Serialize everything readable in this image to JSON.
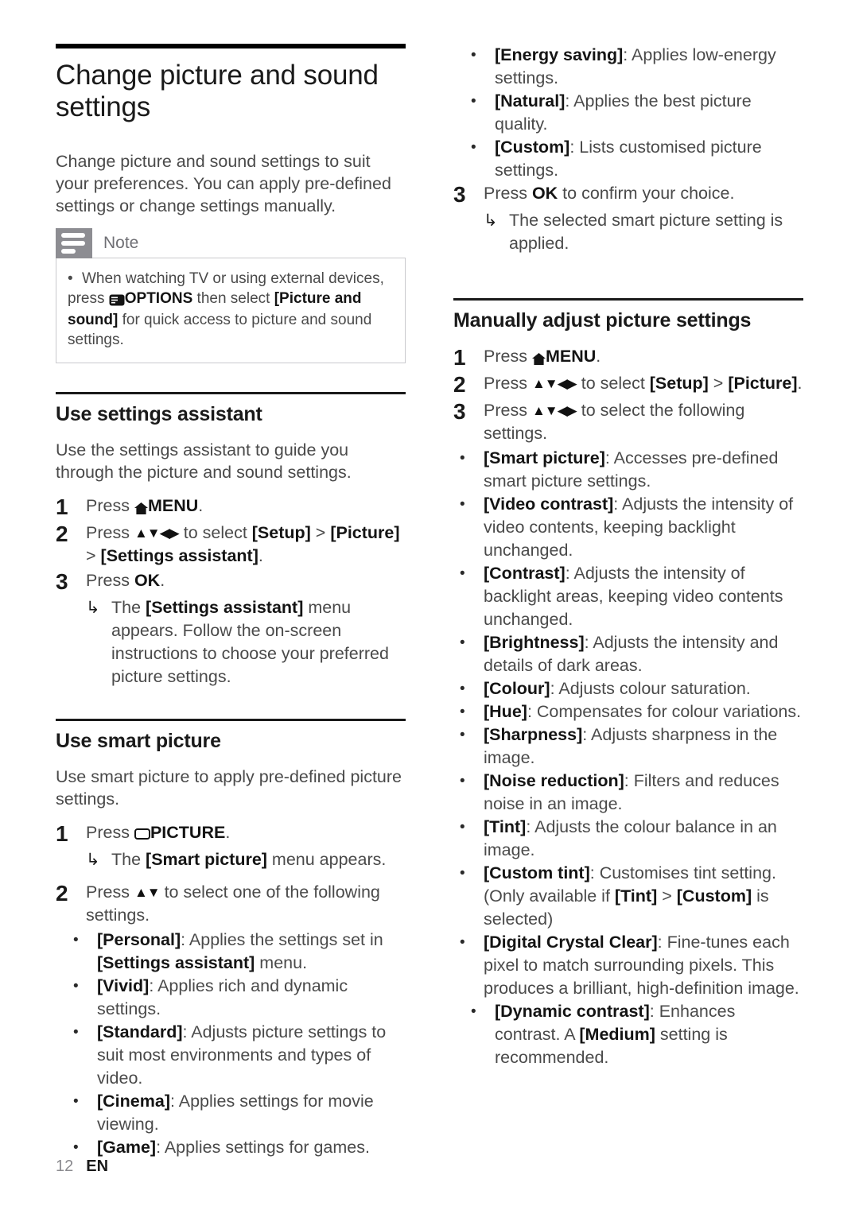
{
  "page": {
    "title": "Change picture and sound settings",
    "intro": "Change picture and sound settings to suit your preferences. You can apply pre-defined settings or change settings manually.",
    "footer_page_number": "12",
    "footer_language": "EN"
  },
  "note": {
    "label": "Note",
    "icon": "note-lines-icon",
    "bullet_pre": "When watching TV or using external devices, press ",
    "options_key": "OPTIONS",
    "bullet_mid": " then select ",
    "picture_and_sound": "[Picture and sound]",
    "bullet_post": " for quick access to picture and sound settings."
  },
  "settings_assistant": {
    "heading": "Use settings assistant",
    "intro": "Use the settings assistant to guide you through the picture and sound settings.",
    "steps": [
      {
        "num": "1",
        "pre": "Press ",
        "key": "MENU",
        "post": "."
      },
      {
        "num": "2",
        "pre": "Press ",
        "arrows": "▲▼◀▶",
        "mid": " to select ",
        "b1": "[Setup]",
        "sep": " > ",
        "b2": "[Picture]",
        "sep2": " > ",
        "b3": "[Settings assistant]",
        "post": "."
      },
      {
        "num": "3",
        "pre": "Press ",
        "key": "OK",
        "post": "."
      }
    ],
    "result": {
      "pre": "The ",
      "bold": "[Settings assistant]",
      "post": " menu appears. Follow the on-screen instructions to choose your preferred picture settings."
    }
  },
  "smart_picture": {
    "heading": "Use smart picture",
    "intro": "Use smart picture to apply pre-defined picture settings.",
    "step1": {
      "num": "1",
      "pre": "Press ",
      "key": "PICTURE",
      "post": "."
    },
    "step1_result": {
      "pre": "The ",
      "bold": "[Smart picture]",
      "post": " menu appears."
    },
    "step2": {
      "num": "2",
      "pre": "Press ",
      "arrows": "▲▼",
      "post": " to select one of the following settings."
    },
    "options": [
      {
        "name": "[Personal]",
        "desc": ": Applies the settings set in ",
        "bold2": "[Settings assistant]",
        "desc2": " menu."
      },
      {
        "name": "[Vivid]",
        "desc": ": Applies rich and dynamic settings."
      },
      {
        "name": "[Standard]",
        "desc": ": Adjusts picture settings to suit most environments and types of video."
      },
      {
        "name": "[Cinema]",
        "desc": ": Applies settings for movie viewing."
      },
      {
        "name": "[Game]",
        "desc": ": Applies settings for games."
      },
      {
        "name": "[Energy saving]",
        "desc": ": Applies low-energy settings."
      },
      {
        "name": "[Natural]",
        "desc": ": Applies the best picture quality."
      },
      {
        "name": "[Custom]",
        "desc": ": Lists customised picture settings."
      }
    ],
    "step3": {
      "num": "3",
      "pre": "Press ",
      "key": "OK",
      "post": " to confirm your choice."
    },
    "step3_result": {
      "text": "The selected smart picture setting is applied."
    }
  },
  "manual_picture": {
    "heading": "Manually adjust picture settings",
    "steps": [
      {
        "num": "1",
        "pre": "Press ",
        "key": "MENU",
        "post": "."
      },
      {
        "num": "2",
        "pre": "Press ",
        "arrows": "▲▼◀▶",
        "mid": " to select ",
        "b1": "[Setup]",
        "sep": " > ",
        "b2": "[Picture]",
        "post": "."
      },
      {
        "num": "3",
        "pre": "Press ",
        "arrows": "▲▼◀▶",
        "post": " to select the following settings."
      }
    ],
    "options": [
      {
        "name": "[Smart picture]",
        "desc": ": Accesses pre-defined smart picture settings."
      },
      {
        "name": "[Video contrast]",
        "desc": ": Adjusts the intensity of video contents, keeping backlight unchanged."
      },
      {
        "name": "[Contrast]",
        "desc": ": Adjusts the intensity of backlight areas, keeping video contents unchanged."
      },
      {
        "name": "[Brightness]",
        "desc": ": Adjusts the intensity and details of dark areas."
      },
      {
        "name": "[Colour]",
        "desc": ": Adjusts colour saturation."
      },
      {
        "name": "[Hue]",
        "desc": ": Compensates for colour variations."
      },
      {
        "name": "[Sharpness]",
        "desc": ": Adjusts sharpness in the image."
      },
      {
        "name": "[Noise reduction]",
        "desc": ": Filters and reduces noise in an image."
      },
      {
        "name": "[Tint]",
        "desc": ": Adjusts the colour balance in an image."
      }
    ],
    "custom_tint": {
      "name": "[Custom tint]",
      "desc": ": Customises tint setting. (Only available if ",
      "b1": "[Tint]",
      "sep": " > ",
      "b2": "[Custom]",
      "desc2": " is selected)"
    },
    "dcc": {
      "name": "[Digital Crystal Clear]",
      "desc": ": Fine-tunes each pixel to match surrounding pixels. This produces a brilliant, high-definition image."
    },
    "dynamic_contrast": {
      "name": "[Dynamic contrast]",
      "desc": ": Enhances contrast. A ",
      "bold2": "[Medium]",
      "desc2": " setting is recommended."
    }
  },
  "glyphs": {
    "bullet": "•",
    "result_arrow": "↳"
  }
}
